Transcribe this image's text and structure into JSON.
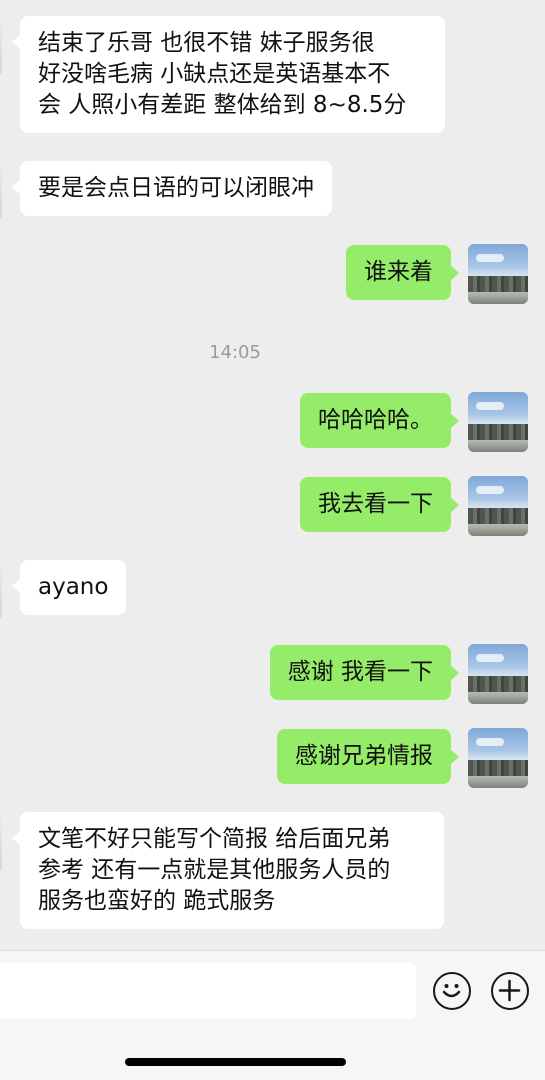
{
  "messages": [
    {
      "side": "left",
      "lines": [
        "结束了乐哥   也很不错 妹子服务很",
        "好没啥毛病 小缺点还是英语基本不",
        "会 人照小有差距  整体给到 8~8.5分"
      ]
    },
    {
      "side": "left",
      "lines": [
        "要是会点日语的可以闭眼冲"
      ]
    },
    {
      "side": "right",
      "lines": [
        "谁来着"
      ]
    },
    {
      "side": "right",
      "lines": [
        "哈哈哈哈。"
      ]
    },
    {
      "side": "right",
      "lines": [
        "我去看一下"
      ]
    },
    {
      "side": "left",
      "lines": [
        "ayano"
      ]
    },
    {
      "side": "right",
      "lines": [
        "感谢 我看一下"
      ]
    },
    {
      "side": "right",
      "lines": [
        "感谢兄弟情报"
      ]
    },
    {
      "side": "left",
      "lines": [
        "文笔不好只能写个简报 给后面兄弟",
        "参考  还有一点就是其他服务人员的",
        "服务也蛮好的 跪式服务"
      ]
    }
  ],
  "timestamp": "14:05",
  "input": {
    "value": "",
    "placeholder": ""
  },
  "icons": {
    "emoji": "emoji-icon",
    "plus": "plus-icon"
  },
  "colors": {
    "background": "#ededed",
    "my_bubble": "#95ec69",
    "their_bubble": "#ffffff"
  }
}
